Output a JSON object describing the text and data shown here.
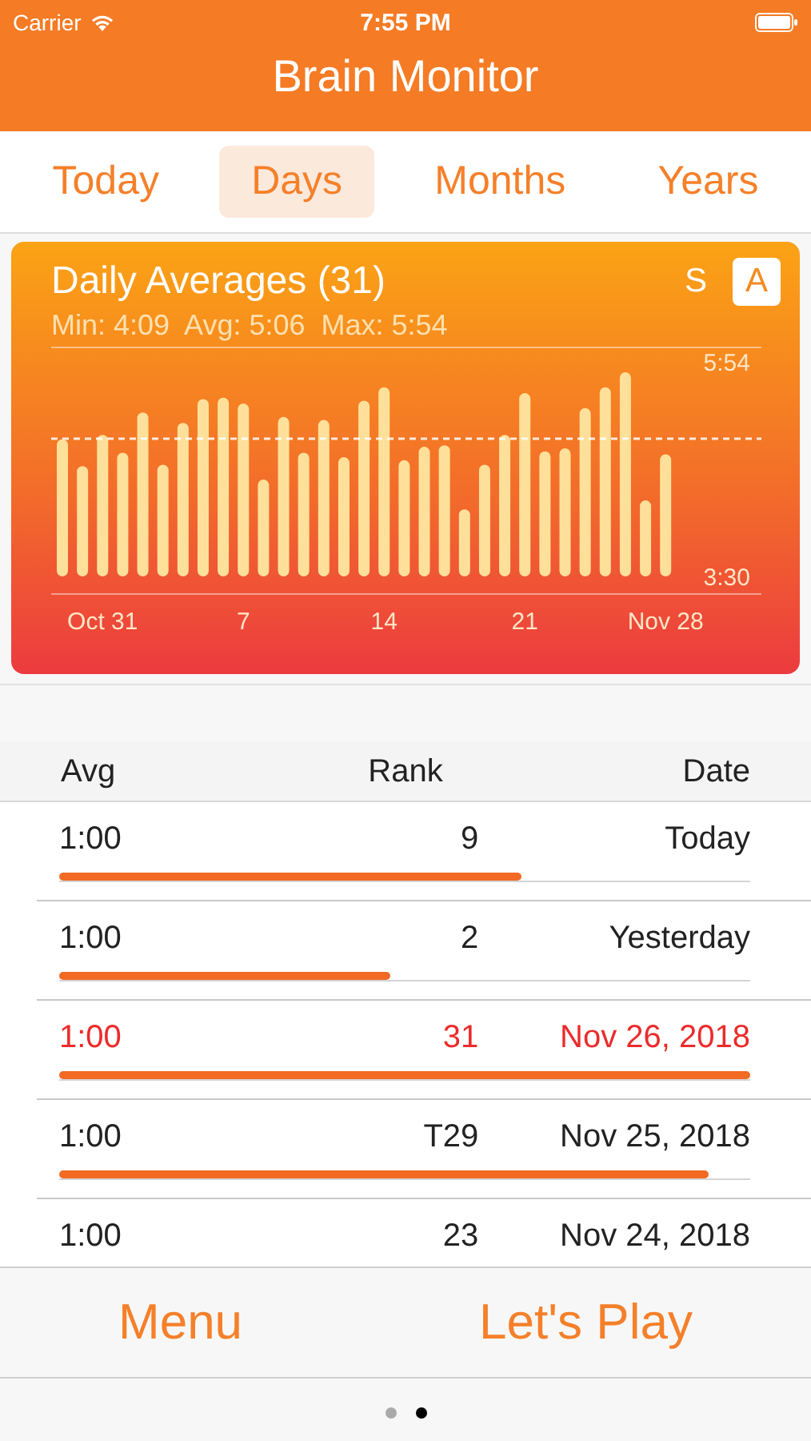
{
  "status_bar": {
    "carrier": "Carrier",
    "time": "7:55 PM"
  },
  "header": {
    "title": "Brain Monitor"
  },
  "tabs": [
    {
      "label": "Today",
      "selected": false
    },
    {
      "label": "Days",
      "selected": true
    },
    {
      "label": "Months",
      "selected": false
    },
    {
      "label": "Years",
      "selected": false
    }
  ],
  "chart_card": {
    "title": "Daily Averages (31)",
    "summary": "Min: 4:09  Avg: 5:06  Max: 5:54",
    "toggles": [
      {
        "label": "S",
        "selected": false
      },
      {
        "label": "A",
        "selected": true
      }
    ],
    "chart_data": {
      "type": "bar",
      "ylim": [
        210,
        354
      ],
      "yticks": [
        {
          "value": 354,
          "label": "5:54"
        },
        {
          "value": 210,
          "label": "3:30"
        }
      ],
      "categories": [
        null,
        null,
        "Oct 31",
        null,
        null,
        null,
        null,
        null,
        null,
        "7",
        null,
        null,
        null,
        null,
        null,
        null,
        "14",
        null,
        null,
        null,
        null,
        null,
        null,
        "21",
        null,
        null,
        null,
        null,
        null,
        null,
        "Nov 28"
      ],
      "values": [
        302,
        284,
        305,
        293,
        320,
        285,
        313,
        329,
        330,
        326,
        275,
        317,
        293,
        315,
        290,
        328,
        337,
        288,
        297,
        298,
        255,
        285,
        305,
        333,
        294,
        296,
        323,
        337,
        347,
        261,
        292
      ]
    }
  },
  "table": {
    "columns": [
      "Avg",
      "Rank",
      "Date"
    ],
    "rows": [
      {
        "avg": "1:00",
        "rank": "9",
        "date": "Today",
        "level": 0.67,
        "highlighted": false
      },
      {
        "avg": "1:00",
        "rank": "2",
        "date": "Yesterday",
        "level": 0.48,
        "highlighted": false
      },
      {
        "avg": "1:00",
        "rank": "31",
        "date": "Nov 26, 2018",
        "level": 1.0,
        "highlighted": true
      },
      {
        "avg": "1:00",
        "rank": "T29",
        "date": "Nov 25, 2018",
        "level": 0.94,
        "highlighted": false
      },
      {
        "avg": "1:00",
        "rank": "23",
        "date": "Nov 24, 2018",
        "highlighted": false
      }
    ]
  },
  "footer": {
    "buttons": [
      "Menu",
      "Let's Play"
    ]
  },
  "page_dots": [
    {
      "selected": false
    },
    {
      "selected": true
    }
  ]
}
